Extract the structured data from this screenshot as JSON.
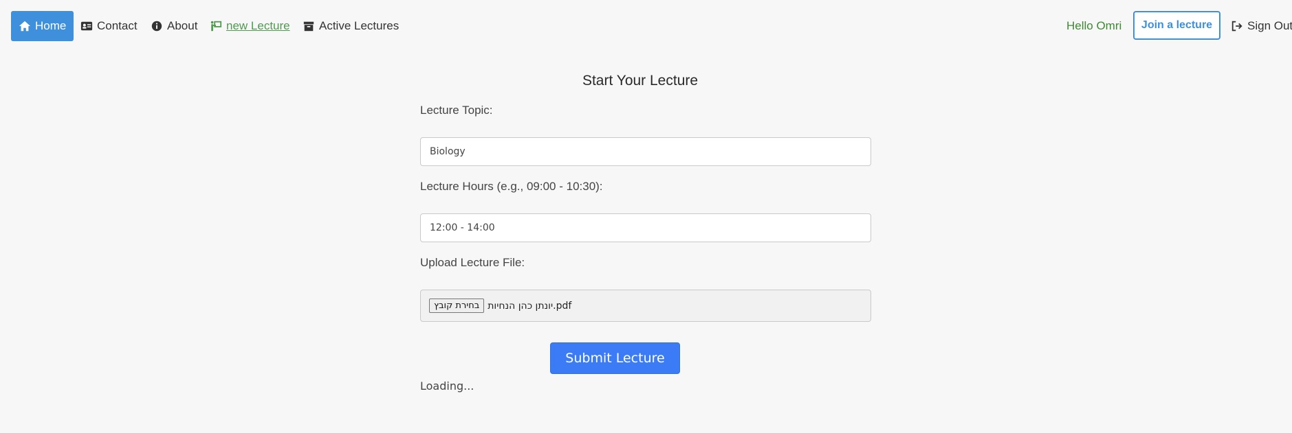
{
  "nav": {
    "home_label": "Home",
    "contact_label": "Contact",
    "about_label": "About",
    "new_lecture_label": " new Lecture",
    "active_lectures_label": "Active Lectures",
    "greeting": "Hello Omri",
    "join_label": "Join a lecture",
    "signout_label": "Sign Out",
    "icons": [
      "home-icon",
      "contact-card-icon",
      "info-icon",
      "teacher-board-icon",
      "archive-icon",
      "sign-out-icon"
    ]
  },
  "form": {
    "title": "Start Your Lecture",
    "topic_label": "Lecture Topic:",
    "topic_value": "Biology",
    "hours_label": "Lecture Hours (e.g., 09:00 - 10:30):",
    "hours_value": "12:00 - 14:00",
    "file_label": "Upload Lecture File:",
    "file_button": "בחירת קובץ",
    "file_name": "יונתן כהן הנחיות.pdf",
    "submit_label": "Submit Lecture",
    "status": "Loading..."
  },
  "colors": {
    "accent": "#3e8fdc",
    "submit": "#3b7cf6",
    "greeting": "#3d8a32",
    "new_lecture": "#4f9a4f",
    "background": "#f7f7f7"
  }
}
